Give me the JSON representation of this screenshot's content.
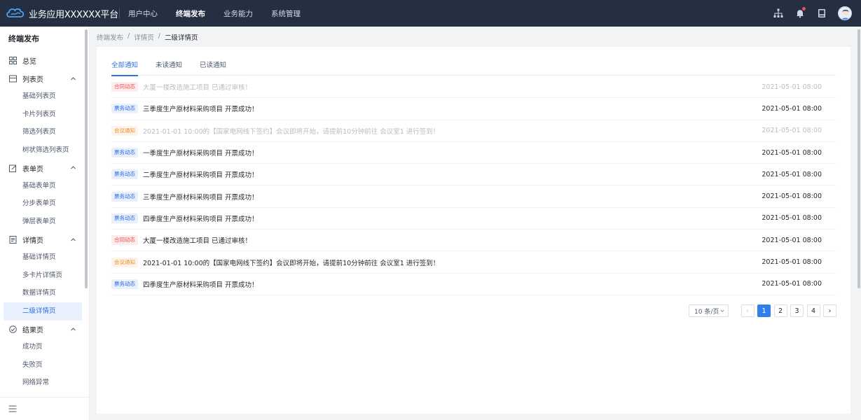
{
  "app": {
    "title": "业务应用XXXXXX平台"
  },
  "topnav": [
    {
      "label": "用户中心",
      "active": false
    },
    {
      "label": "终端发布",
      "active": true
    },
    {
      "label": "业务能力",
      "active": false
    },
    {
      "label": "系统管理",
      "active": false
    }
  ],
  "topicons": [
    "sitemap-icon",
    "bell-icon",
    "book-icon",
    "avatar"
  ],
  "sidebar": {
    "title": "终端发布",
    "overview": "总览",
    "groups": [
      {
        "label": "列表页",
        "items": [
          "基础列表页",
          "卡片列表页",
          "筛选列表页",
          "树状筛选列表页"
        ]
      },
      {
        "label": "表单页",
        "items": [
          "基础表单页",
          "分步表单页",
          "弹层表单页"
        ]
      },
      {
        "label": "详情页",
        "items": [
          "基础详情页",
          "多卡片详情页",
          "数据详情页",
          "二级详情页"
        ]
      },
      {
        "label": "结果页",
        "items": [
          "成功页",
          "失败页",
          "网络异常"
        ]
      }
    ],
    "active_item": "二级详情页"
  },
  "breadcrumb": [
    "终端发布",
    "详情页",
    "二级详情页"
  ],
  "breadcrumb_sep": "/",
  "tabs": [
    {
      "label": "全部通知",
      "active": true
    },
    {
      "label": "未读通知",
      "active": false
    },
    {
      "label": "已读通知",
      "active": false
    }
  ],
  "notifications": [
    {
      "tag": "合同动态",
      "type": "contract",
      "text": "大厦一楼改造施工项目 已通过审核！",
      "time": "2021-05-01 08:00",
      "read": true
    },
    {
      "tag": "票务动态",
      "type": "ticket",
      "text": "三季度生产原材料采购项目 开票成功！",
      "time": "2021-05-01 08:00",
      "read": false
    },
    {
      "tag": "会议通知",
      "type": "meeting",
      "text": "2021-01-01 10:00的【国家电网线下签约】会议即将开始，请提前10分钟前往 会议室1 进行签到！",
      "time": "2021-05-01 08:00",
      "read": true
    },
    {
      "tag": "票务动态",
      "type": "ticket",
      "text": "一季度生产原材料采购项目 开票成功！",
      "time": "2021-05-01 08:00",
      "read": false
    },
    {
      "tag": "票务动态",
      "type": "ticket",
      "text": "二季度生产原材料采购项目 开票成功！",
      "time": "2021-05-01 08:00",
      "read": false
    },
    {
      "tag": "票务动态",
      "type": "ticket",
      "text": "三季度生产原材料采购项目 开票成功！",
      "time": "2021-05-01 08:00",
      "read": false
    },
    {
      "tag": "票务动态",
      "type": "ticket",
      "text": "四季度生产原材料采购项目 开票成功！",
      "time": "2021-05-01 08:00",
      "read": false
    },
    {
      "tag": "合同动态",
      "type": "contract",
      "text": "大厦一楼改造施工项目 已通过审核！",
      "time": "2021-05-01 08:00",
      "read": false
    },
    {
      "tag": "会议通知",
      "type": "meeting",
      "text": "2021-01-01 10:00的【国家电网线下签约】会议即将开始，请提前10分钟前往 会议室1 进行签到！",
      "time": "2021-05-01 08:00",
      "read": false
    },
    {
      "tag": "票务动态",
      "type": "ticket",
      "text": "四季度生产原材料采购项目 开票成功！",
      "time": "2021-05-01 08:00",
      "read": false
    }
  ],
  "pagination": {
    "page_size": "10 条/页",
    "prev": "‹",
    "next": "›",
    "pages": [
      "1",
      "2",
      "3",
      "4"
    ],
    "current": "1"
  }
}
